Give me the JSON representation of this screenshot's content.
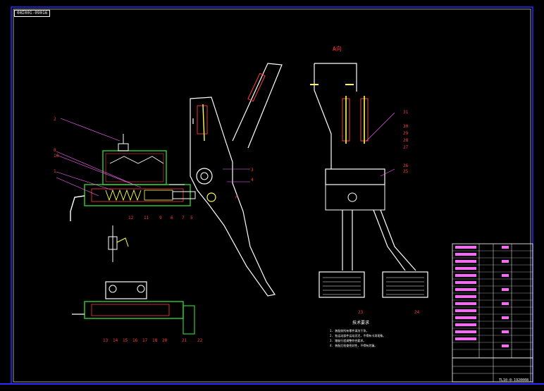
{
  "title_tag": "00Σ001-09016",
  "view_label": "A向",
  "section_label_a": "A",
  "notes_heading": "技术要求",
  "notes": [
    "1. 装配前所有零件清洗干净。",
    "2. 各运动部件运动灵活，不得有卡滞现象。",
    "3. 踏板行程调整符合要求。",
    "4. 装配后检查密封性，不得有泄漏。"
  ],
  "doc_code": "TL10-0-1920008",
  "balloons": [
    "1",
    "2",
    "3",
    "4",
    "5",
    "6",
    "7",
    "8",
    "9",
    "10",
    "11",
    "12",
    "13",
    "14",
    "15",
    "16",
    "17",
    "18",
    "19",
    "20",
    "21",
    "22",
    "23",
    "24",
    "25",
    "26",
    "27",
    "28",
    "29",
    "30",
    "31"
  ],
  "colors": {
    "background": "#000000",
    "outline": "#ffffff",
    "section": "#33cc33",
    "hatch": "#ff3b3b",
    "leader": "#ff66ff",
    "label": "#ff3b3b",
    "frame": "#2b2bff",
    "metal": "#ffff55"
  }
}
